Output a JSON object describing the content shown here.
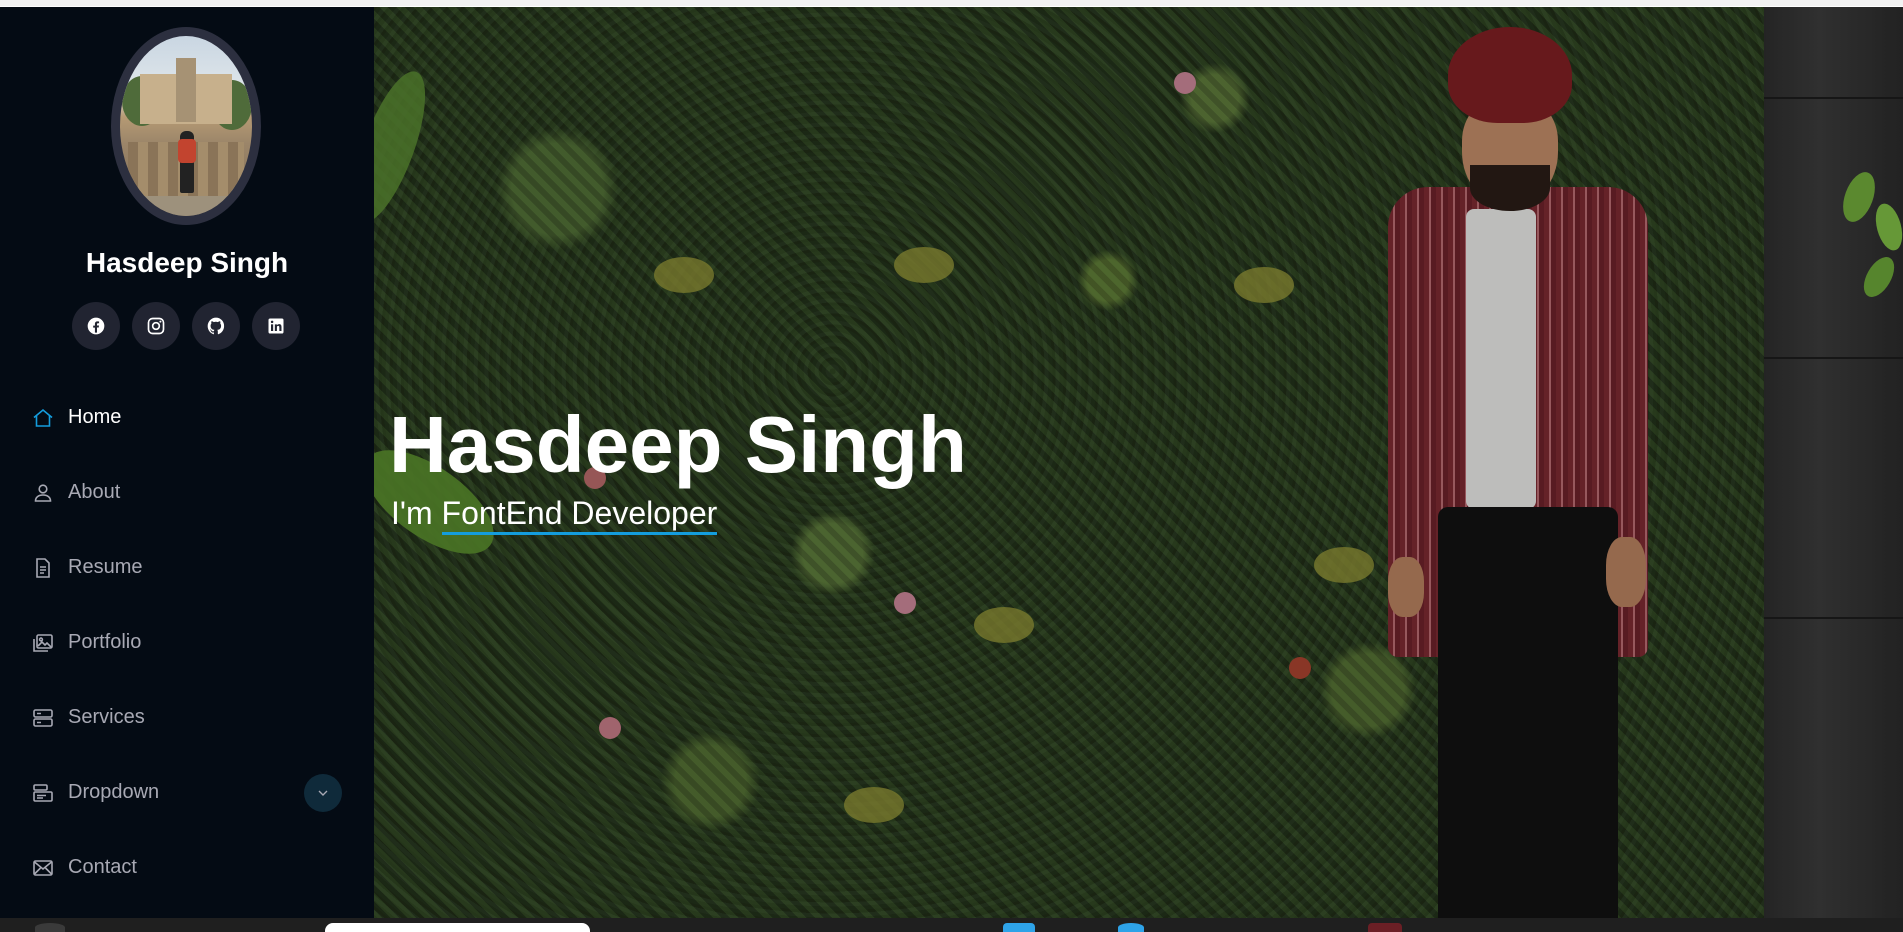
{
  "profile": {
    "name": "Hasdeep Singh",
    "socials": [
      {
        "name": "facebook",
        "icon": "facebook-icon"
      },
      {
        "name": "instagram",
        "icon": "instagram-icon"
      },
      {
        "name": "github",
        "icon": "github-icon"
      },
      {
        "name": "linkedin",
        "icon": "linkedin-icon"
      }
    ]
  },
  "nav": {
    "items": [
      {
        "label": "Home",
        "icon": "home-icon",
        "active": true
      },
      {
        "label": "About",
        "icon": "person-icon"
      },
      {
        "label": "Resume",
        "icon": "file-text-icon"
      },
      {
        "label": "Portfolio",
        "icon": "images-icon"
      },
      {
        "label": "Services",
        "icon": "server-icon"
      },
      {
        "label": "Dropdown",
        "icon": "menu-app-icon",
        "has_submenu": true
      },
      {
        "label": "Contact",
        "icon": "envelope-icon"
      }
    ]
  },
  "hero": {
    "title": "Hasdeep Singh",
    "prefix": "I'm",
    "typed": "FontEnd Developer"
  },
  "colors": {
    "sidebar_bg": "#040b14",
    "accent": "#149ddd",
    "nav_text": "#a8a9b4",
    "social_bg": "#212431"
  }
}
